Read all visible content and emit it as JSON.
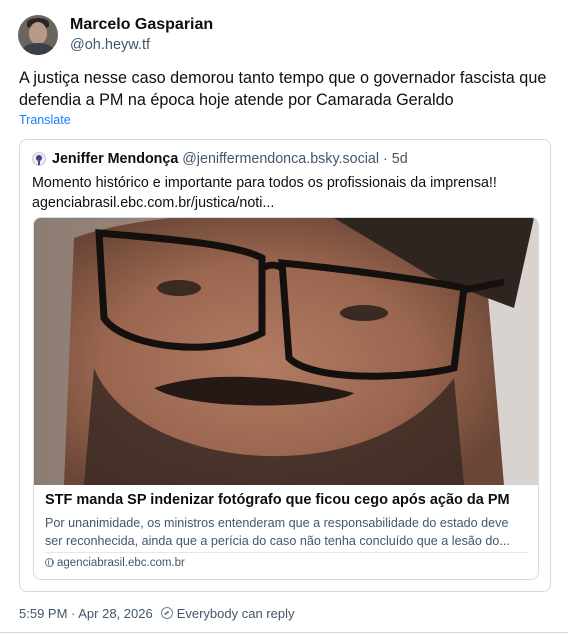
{
  "post": {
    "author_name": "Marcelo Gasparian",
    "author_handle": "@oh.heyw.tf",
    "text": "A justiça nesse caso demorou tanto tempo que o governador fascista que defendia a PM na época hoje atende por Camarada Geraldo",
    "translate_label": "Translate",
    "timestamp": "5:59 PM · Apr 28, 2026",
    "reply_setting": "Everybody can reply"
  },
  "quote": {
    "author_name": "Jeniffer Mendonça",
    "author_handle": "@jeniffermendonca.bsky.social",
    "time_ago": "· 5d",
    "text_line1": "Momento histórico e importante para todos os profissionais da imprensa!!",
    "text_line2": "agenciabrasil.ebc.com.br/justica/noti...",
    "link_card": {
      "title": "STF manda SP indenizar fotógrafo que ficou cego após ação da PM",
      "desc_line1": "Por unanimidade, os ministros entenderam que a responsabilidade do estado deve",
      "desc_line2": "ser reconhecida, ainda que a perícia do caso não tenha concluído que a lesão do...",
      "domain": "agenciabrasil.ebc.com.br"
    }
  },
  "icons": {
    "avatar": "person-avatar",
    "quote_avatar": "pin-avatar-icon",
    "domain": "globe-icon",
    "reply": "reply-setting-icon"
  }
}
